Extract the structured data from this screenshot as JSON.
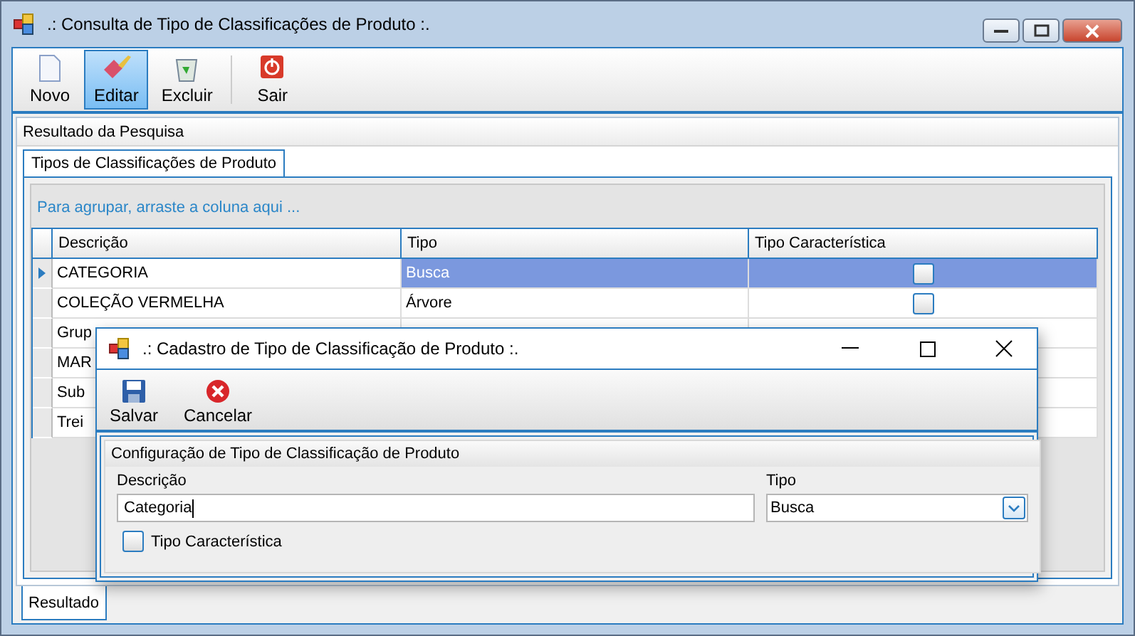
{
  "window": {
    "title": ".: Consulta de Tipo de Classificações de Produto :."
  },
  "toolbar": [
    {
      "label": "Novo",
      "kind": "new",
      "selected": false
    },
    {
      "label": "Editar",
      "kind": "edit",
      "selected": true
    },
    {
      "label": "Excluir",
      "kind": "delete",
      "selected": false
    },
    {
      "label": "Sair",
      "kind": "exit",
      "selected": false
    }
  ],
  "results_panel": {
    "title": "Resultado da Pesquisa"
  },
  "inner_tabs": [
    {
      "label": "Tipos de Classificações de Produto",
      "selected": true
    }
  ],
  "grid": {
    "group_hint": "Para agrupar, arraste a coluna aqui ...",
    "columns": [
      "Descrição",
      "Tipo",
      "Tipo Característica"
    ],
    "rows": [
      {
        "descricao": "CATEGORIA",
        "tipo": "Busca",
        "caracteristica": false,
        "selected": true,
        "current": true
      },
      {
        "descricao": "COLEÇÃO VERMELHA",
        "tipo": "Árvore",
        "caracteristica": false,
        "selected": false,
        "current": false
      },
      {
        "descricao": "Grup",
        "current": false
      },
      {
        "descricao": "MAR",
        "current": false
      },
      {
        "descricao": "Sub",
        "current": false
      },
      {
        "descricao": "Trei",
        "current": false
      }
    ]
  },
  "bottom_tabs": [
    {
      "label": "Resultado",
      "selected": true
    }
  ],
  "dialog": {
    "title": ".: Cadastro de Tipo de Classificação de Produto :.",
    "toolbar": [
      {
        "label": "Salvar",
        "kind": "save"
      },
      {
        "label": "Cancelar",
        "kind": "cancel"
      }
    ],
    "group": {
      "title": "Configuração de Tipo de Classificação de Produto",
      "descricao": {
        "label": "Descrição",
        "value": "Categoria"
      },
      "tipo": {
        "label": "Tipo",
        "value": "Busca"
      },
      "checkbox": {
        "label": "Tipo Característica",
        "checked": false
      }
    }
  }
}
